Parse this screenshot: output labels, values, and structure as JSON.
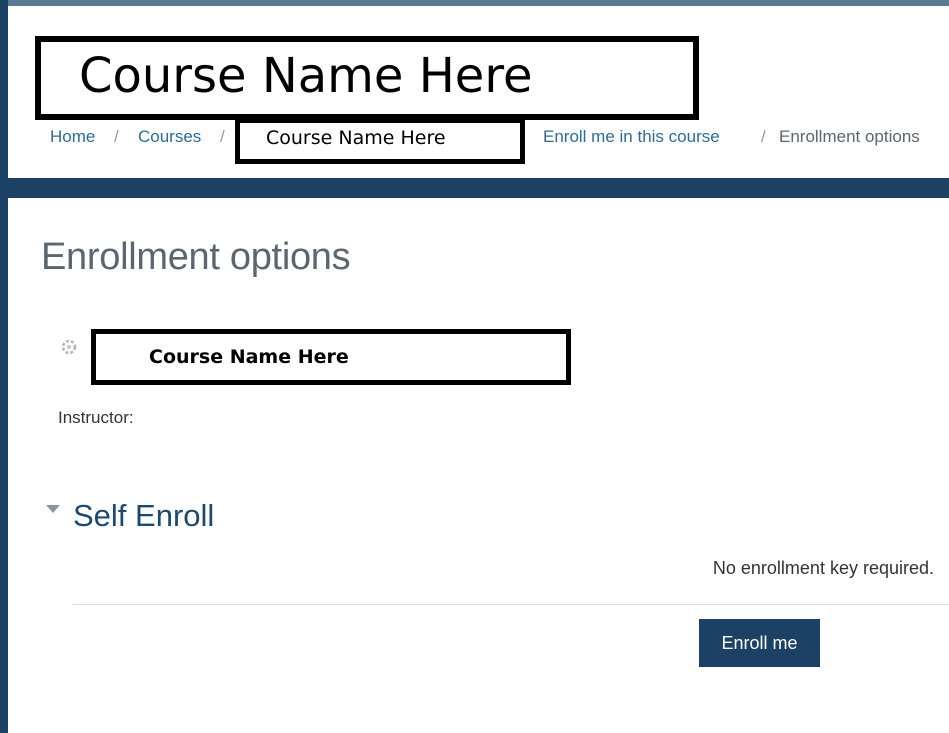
{
  "header": {
    "course_title": "Course Name Here"
  },
  "breadcrumb": {
    "home": "Home",
    "courses": "Courses",
    "course_name": "Course Name Here",
    "enroll": "Enroll me in this course",
    "current": "Enrollment options",
    "separator": "/"
  },
  "main": {
    "page_title": "Enrollment options",
    "course_name": "Course Name Here",
    "instructor_label": "Instructor:"
  },
  "self_enroll": {
    "title": "Self Enroll",
    "note": "No enrollment key required.",
    "button_label": "Enroll me"
  },
  "colors": {
    "brand_navy": "#1b4264",
    "link_blue": "#2d6b96",
    "section_title": "#1b4a6e"
  },
  "icons": {
    "course_icon": "course-icon",
    "section_toggle": "chevron-down-icon"
  }
}
